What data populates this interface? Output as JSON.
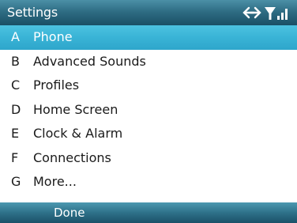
{
  "title_bar": {
    "title": "Settings",
    "icons": [
      "data-connection-icon",
      "signal-strength-icon"
    ]
  },
  "menu": {
    "items": [
      {
        "key": "A",
        "label": "Phone",
        "selected": true
      },
      {
        "key": "B",
        "label": "Advanced Sounds",
        "selected": false
      },
      {
        "key": "C",
        "label": "Profiles",
        "selected": false
      },
      {
        "key": "D",
        "label": "Home Screen",
        "selected": false
      },
      {
        "key": "E",
        "label": "Clock & Alarm",
        "selected": false
      },
      {
        "key": "F",
        "label": "Connections",
        "selected": false
      },
      {
        "key": "G",
        "label": "More...",
        "selected": false
      }
    ]
  },
  "softkeys": {
    "left": "Done"
  },
  "colors": {
    "title_bar": "#2f6d84",
    "selection": "#39b3d6",
    "softkey_bar": "#2e7189",
    "text": "#1a1a1a"
  }
}
